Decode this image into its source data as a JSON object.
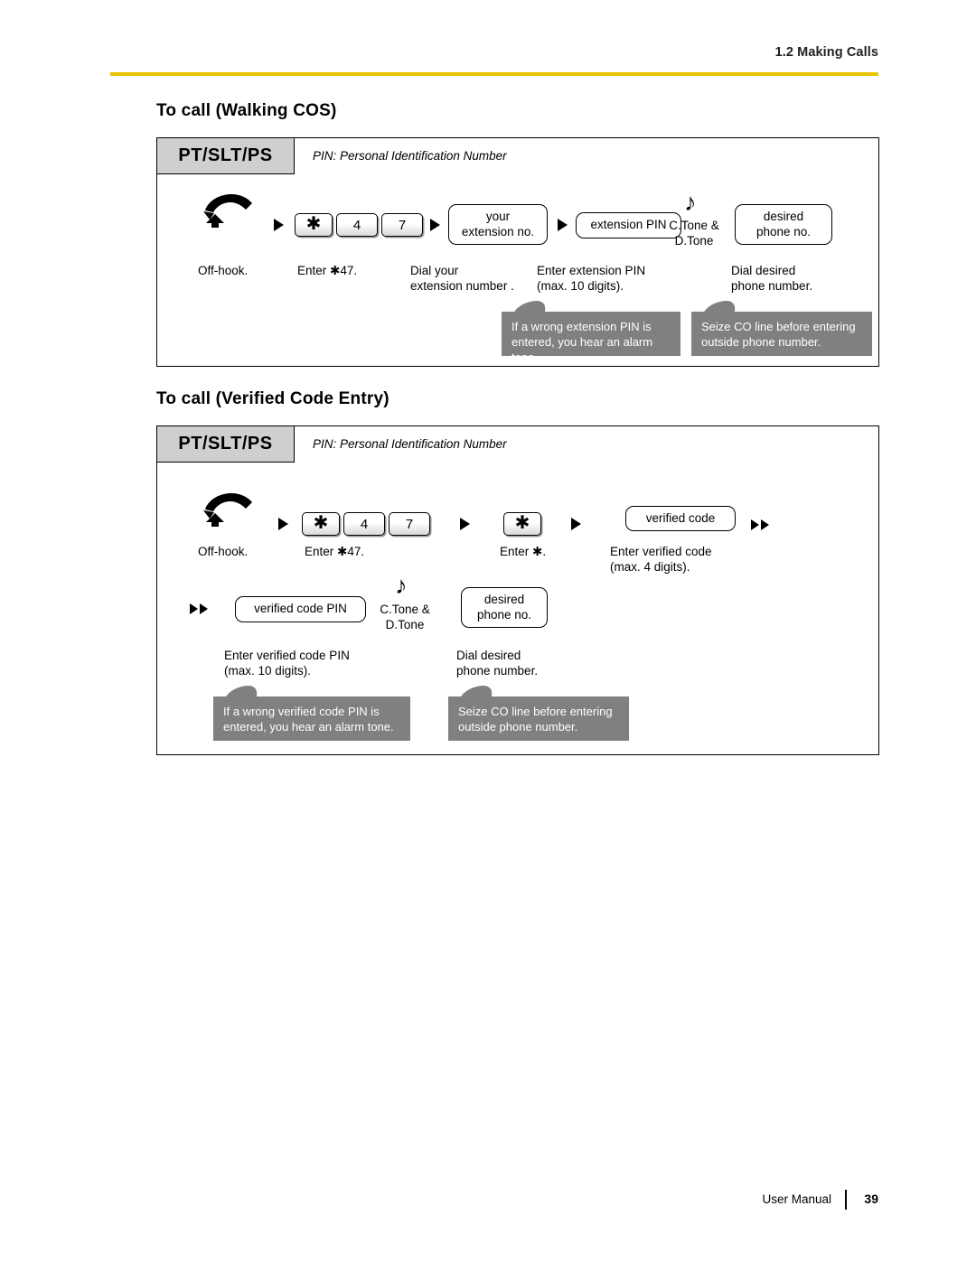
{
  "header": {
    "section_label": "1.2 Making Calls"
  },
  "footer": {
    "manual_label": "User Manual",
    "page_number": "39"
  },
  "sections": [
    {
      "title": "To call (Walking COS)",
      "tab_label": "PT/SLT/PS",
      "pin_note": "PIN: Personal Identification Number",
      "keys": {
        "star": "✱",
        "four": "4",
        "seven": "7"
      },
      "ovals": {
        "your_extension_no_line1": "your",
        "your_extension_no_line2": "extension no.",
        "extension_pin": "extension PIN",
        "desired_line1": "desired",
        "desired_line2": "phone no."
      },
      "captions": {
        "off_hook": "Off-hook.",
        "enter_star_47": "Enter ✱47.",
        "dial_your_ext": "Dial your\nextension number .",
        "enter_ext_pin": "Enter extension PIN\n(max. 10 digits).",
        "dial_desired": "Dial desired\nphone number."
      },
      "tone": "C.Tone &\nD.Tone",
      "balloons": [
        "If a wrong extension PIN is entered, you hear an alarm tone.",
        "Seize CO line before entering outside phone number."
      ]
    },
    {
      "title": "To call (Verified Code Entry)",
      "tab_label": "PT/SLT/PS",
      "pin_note": "PIN: Personal Identification Number",
      "keys": {
        "star": "✱",
        "four": "4",
        "seven": "7",
        "star2": "✱"
      },
      "ovals": {
        "verified_code": "verified code",
        "verified_code_pin": "verified code PIN",
        "desired_line1": "desired",
        "desired_line2": "phone no."
      },
      "captions": {
        "off_hook": "Off-hook.",
        "enter_star_47": "Enter ✱47.",
        "enter_star": "Enter ✱.",
        "enter_verified_code": "Enter verified code\n(max. 4 digits).",
        "enter_verified_code_pin": "Enter verified code PIN\n(max. 10 digits).",
        "dial_desired": "Dial desired\nphone number."
      },
      "tone": "C.Tone &\nD.Tone",
      "balloons": [
        "If a wrong verified code PIN is entered, you hear an alarm tone.",
        "Seize CO line before entering outside phone number."
      ]
    }
  ]
}
